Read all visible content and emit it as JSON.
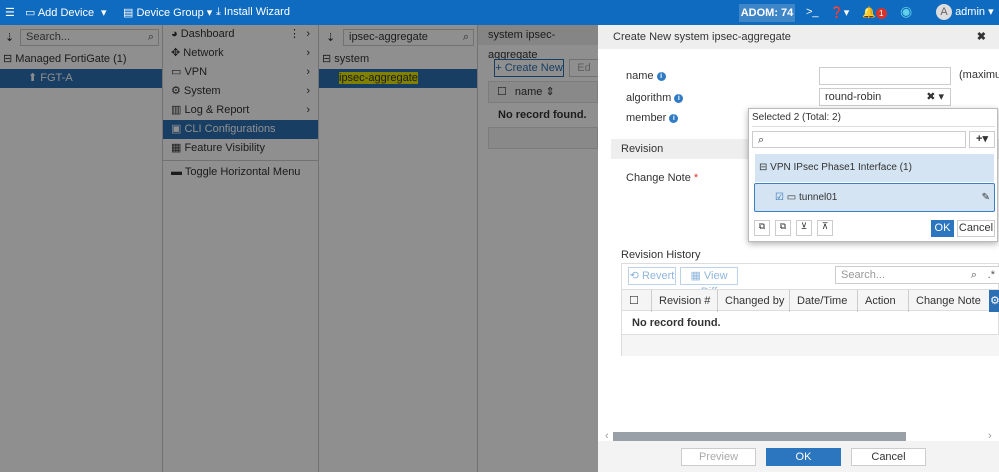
{
  "topbar": {
    "add_device": "Add Device",
    "device_group": "Device Group",
    "install_wizard": "Install Wizard",
    "adom": "ADOM: 74",
    "notif_count": "1",
    "user": "admin",
    "avatar_letter": "A"
  },
  "left": {
    "search_placeholder": "Search...",
    "group": "Managed FortiGate (1)",
    "device": "FGT-A"
  },
  "menu": {
    "items": [
      "Dashboard",
      "Network",
      "VPN",
      "System",
      "Log & Report",
      "CLI Configurations",
      "Feature Visibility",
      "Toggle Horizontal Menu"
    ]
  },
  "tree": {
    "search_value": "ipsec-aggregate",
    "root": "system",
    "item": "ipsec-aggregate"
  },
  "content": {
    "title": "system ipsec-aggregate",
    "create_new": "+ Create New",
    "edit": "Ed",
    "col_name": "name",
    "empty": "No record found."
  },
  "modal": {
    "title": "Create New system ipsec-aggregate",
    "name_label": "name",
    "name_hint": "(maximum",
    "algorithm_label": "algorithm",
    "algorithm_value": "round-robin",
    "member_label": "member",
    "revision_section": "Revision",
    "change_note_label": "Change Note",
    "revision_history": "Revision History",
    "revert": "Revert",
    "view_diff": "View Diff",
    "search_placeholder": "Search...",
    "columns": [
      "Revision #",
      "Changed by",
      "Date/Time",
      "Action",
      "Change Note"
    ],
    "empty": "No record found.",
    "preview": "Preview",
    "ok": "OK",
    "cancel": "Cancel"
  },
  "dropdown": {
    "selected": "Selected 2 (Total: 2)",
    "group": "VPN IPsec Phase1 Interface (1)",
    "item": "tunnel01",
    "ok": "OK",
    "cancel": "Cancel"
  }
}
